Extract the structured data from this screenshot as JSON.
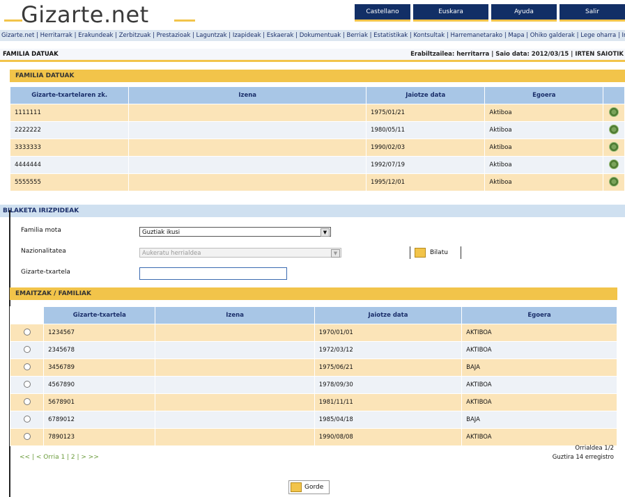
{
  "header": {
    "logo_text": "Gizarte.net",
    "nav_tabs": [
      "Castellano",
      "Euskara",
      "Ayuda",
      "Salir"
    ]
  },
  "linkbar": {
    "text": "Gizarte.net | Herritarrak | Erakundeak | Zerbitzuak | Prestazioak | Laguntzak | Izapideak | Eskaerak | Dokumentuak | Berriak | Estatistikak | Kontsultak | Harremanetarako | Mapa | Ohiko galderak | Lege oharra | Irisgarritasuna"
  },
  "breadcrumb": {
    "left": "FAMILIA DATUAK",
    "right": "Erabiltzailea: herritarra | Saio data: 2012/03/15 | IRTEN SAIOTIK"
  },
  "family_table": {
    "title": "FAMILIA DATUAK",
    "columns": [
      "Gizarte-txartelaren zk.",
      "Izena",
      "Jaiotze data",
      "Egoera"
    ],
    "rows": [
      {
        "id": "1111111",
        "name": "",
        "birth": "1975/01/21",
        "status": "Aktiboa"
      },
      {
        "id": "2222222",
        "name": "",
        "birth": "1980/05/11",
        "status": "Aktiboa"
      },
      {
        "id": "3333333",
        "name": "",
        "birth": "1990/02/03",
        "status": "Aktiboa"
      },
      {
        "id": "4444444",
        "name": "",
        "birth": "1992/07/19",
        "status": "Aktiboa"
      },
      {
        "id": "5555555",
        "name": "",
        "birth": "1995/12/01",
        "status": "Aktiboa"
      }
    ]
  },
  "search": {
    "title": "BILAKETA IRIZPIDEAK",
    "labels": {
      "type": "Familia mota",
      "nationality": "Nazionalitatea",
      "card": "Gizarte-txartela"
    },
    "type_value": "Guztiak ikusi",
    "nationality_value": "Aukeratu herrialdea",
    "card_value": "",
    "search_button": "Bilatu"
  },
  "results_table": {
    "title": "EMAITZAK / FAMILIAK",
    "columns": [
      "Gizarte-txartela",
      "Izena",
      "Jaiotze data",
      "Egoera"
    ],
    "rows": [
      {
        "id": "1234567",
        "name": "",
        "birth": "1970/01/01",
        "status": "AKTIBOA"
      },
      {
        "id": "2345678",
        "name": "",
        "birth": "1972/03/12",
        "status": "AKTIBOA"
      },
      {
        "id": "3456789",
        "name": "",
        "birth": "1975/06/21",
        "status": "BAJA"
      },
      {
        "id": "4567890",
        "name": "",
        "birth": "1978/09/30",
        "status": "AKTIBOA"
      },
      {
        "id": "5678901",
        "name": "",
        "birth": "1981/11/11",
        "status": "AKTIBOA"
      },
      {
        "id": "6789012",
        "name": "",
        "birth": "1985/04/18",
        "status": "BAJA"
      },
      {
        "id": "7890123",
        "name": "",
        "birth": "1990/08/08",
        "status": "AKTIBOA"
      }
    ]
  },
  "pager": {
    "links": "<< | < Orria 1 | 2 | > >>",
    "info_line1": "Orrialdea 1/2",
    "info_line2": "Guztira 14 erregistro"
  },
  "footer": {
    "button": "Gorde"
  }
}
